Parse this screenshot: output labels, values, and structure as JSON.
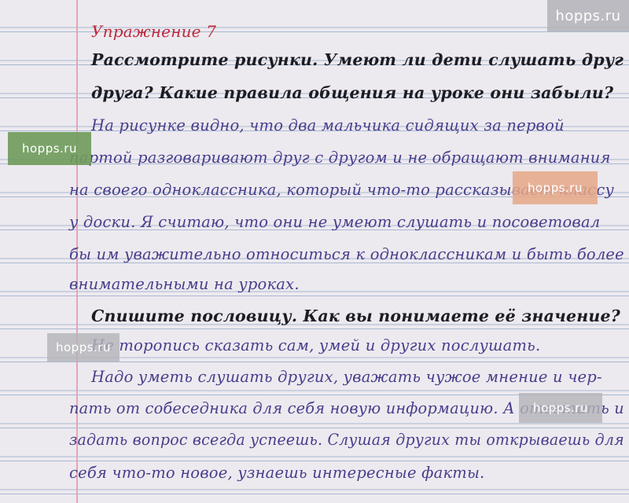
{
  "exercise_title": "Упражнение 7",
  "task1": {
    "line1": "Рассмотрите рисунки. Умеют ли дети слушать друг",
    "line2": "друга? Какие правила общения на уроке они забыли?"
  },
  "answer1": [
    "На рисунке видно, что два мальчика сидящих за первой",
    "партой разговаривают друг с другом и не обращают внимания",
    "на своего одноклассника, который что-то рассказывает классу",
    "у доски. Я считаю, что они не умеют слушать и посоветовал",
    "бы им уважительно относиться к одноклассникам и быть более",
    "внимательными на уроках."
  ],
  "task2": {
    "line1": "Спишите пословицу. Как вы понимаете её значение?"
  },
  "proverb": "Не торопись сказать сам, умей и других послушать.",
  "answer2": [
    "Надо уметь слушать других, уважать чужое мнение и чер-",
    "пать от собеседника для себя новую информацию. А ответить и",
    "задать вопрос всегда успеешь. Слушая других ты открываешь для",
    "себя что-то новое, узнаешь интересные факты."
  ],
  "watermarks": {
    "top_right": "hopps.ru",
    "left_green": "hopps.ru",
    "middle_orange": "hopps.ru",
    "left_gray": "hopps.ru",
    "right_gray": "hopps.ru"
  },
  "colors": {
    "task_ink": "#1c1c22",
    "answer_ink": "#4a3d8c",
    "heading_ink": "#c0283a",
    "watermark_green": "#6f9b5a",
    "watermark_orange": "#e6a786",
    "watermark_gray": "#b4b3b8"
  }
}
